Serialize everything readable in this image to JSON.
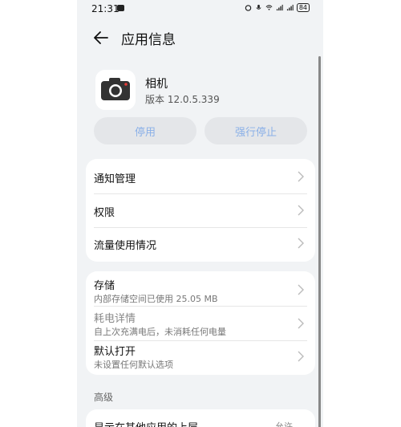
{
  "status_bar": {
    "time": "21:31",
    "battery": "84"
  },
  "header": {
    "title": "应用信息"
  },
  "app": {
    "name": "相机",
    "version": "版本 12.0.5.339"
  },
  "actions": {
    "disable_label": "停用",
    "force_stop_label": "强行停止"
  },
  "card1": [
    {
      "label": "通知管理"
    },
    {
      "label": "权限"
    },
    {
      "label": "流量使用情况"
    }
  ],
  "card2": [
    {
      "label": "存储",
      "sub": "内部存储空间已使用 25.05 MB"
    },
    {
      "label": "耗电详情",
      "sub": "自上次充满电后，未消耗任何电量"
    },
    {
      "label": "默认打开",
      "sub": "未设置任何默认选项"
    }
  ],
  "advanced": {
    "section_label": "高级",
    "row_label": "显示在其他应用的上层",
    "row_value": "允许"
  },
  "colors": {
    "accent_disabled": "#8ab0e8",
    "page_bg": "#f1f3f5"
  }
}
